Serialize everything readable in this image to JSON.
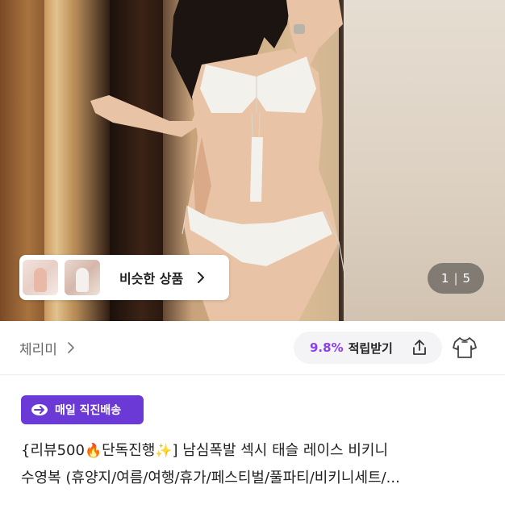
{
  "product_image": {
    "similar_label": "비슷한 상품",
    "pager_current": "1",
    "pager_separator": "|",
    "pager_total": "5"
  },
  "seller": {
    "name": "체리미",
    "reward_rate": "9.8%",
    "reward_label": "적립받기"
  },
  "badge": {
    "label": "매일 직진배송"
  },
  "title": {
    "line1_prefix": "{리뷰500",
    "line1_emoji1": "🔥",
    "line1_mid": "단독진행",
    "line1_emoji2": "✨",
    "line1_suffix": "] 남심폭발 섹시 태슬 레이스 비키니",
    "line2": "수영복 (휴양지/여름/여행/휴가/페스티벌/풀파티/비키니세트/..."
  },
  "colors": {
    "accent_purple": "#6b3ad6",
    "reward_purple": "#8b3ff0"
  },
  "icons": [
    "chevron-right-icon",
    "share-icon",
    "shirt-icon",
    "delivery-arrow-icon"
  ]
}
